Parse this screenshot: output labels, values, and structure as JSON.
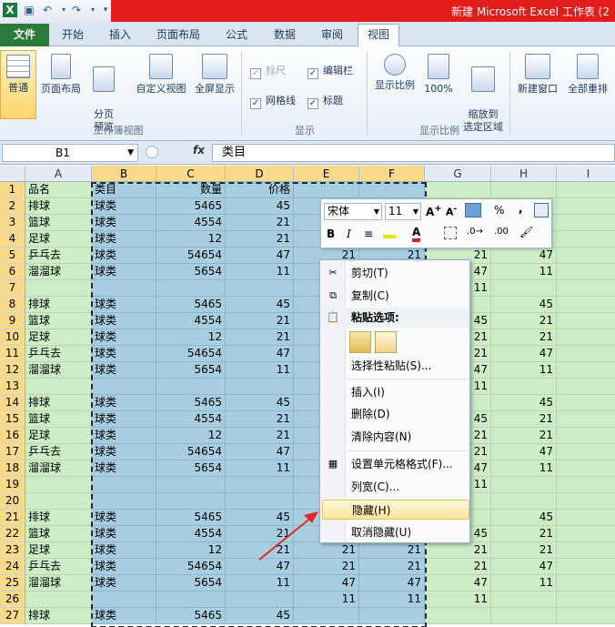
{
  "window": {
    "title": "新建 Microsoft Excel 工作表 (2"
  },
  "tabs": [
    "文件",
    "开始",
    "插入",
    "页面布局",
    "公式",
    "数据",
    "审阅",
    "视图"
  ],
  "ribbon": {
    "btn_normal": "普通",
    "btn_page_layout": "页面布局",
    "btn_page_break": "分页\n预览",
    "btn_custom_view": "自定义视图",
    "btn_full_screen": "全屏显示",
    "group_workbook_view": "工作簿视图",
    "chk_ruler": "标尺",
    "chk_formula_bar": "编辑栏",
    "chk_gridlines": "网格线",
    "chk_headings": "标题",
    "group_show": "显示",
    "btn_zoom": "显示比例",
    "btn_100": "100%",
    "btn_zoom_selection": "缩放到\n选定区域",
    "group_zoom": "显示比例",
    "btn_new_window": "新建窗口",
    "btn_arrange_all": "全部重排"
  },
  "formula_bar": {
    "name_box": "B1",
    "fx": "fx",
    "content": "类目"
  },
  "columns": [
    "A",
    "B",
    "C",
    "D",
    "E",
    "F",
    "G",
    "H",
    "I"
  ],
  "rows": [
    {
      "n": "1",
      "A": "品名",
      "B": "类目",
      "C": "数量",
      "D": "价格",
      "E": "",
      "F": "",
      "G": "",
      "H": ""
    },
    {
      "n": "2",
      "A": "排球",
      "B": "球类",
      "C": "5465",
      "D": "45",
      "E": "",
      "F": "",
      "G": "",
      "H": ""
    },
    {
      "n": "3",
      "A": "篮球",
      "B": "球类",
      "C": "4554",
      "D": "21",
      "E": "",
      "F": "",
      "G": "",
      "H": ""
    },
    {
      "n": "4",
      "A": "足球",
      "B": "球类",
      "C": "12",
      "D": "21",
      "E": "",
      "F": "",
      "G": "",
      "H": ""
    },
    {
      "n": "5",
      "A": "乒乓去",
      "B": "球类",
      "C": "54654",
      "D": "47",
      "E": "21",
      "F": "21",
      "G": "21",
      "H": "47"
    },
    {
      "n": "6",
      "A": "溜溜球",
      "B": "球类",
      "C": "5654",
      "D": "11",
      "E": "",
      "F": "",
      "G": "47",
      "H": "11"
    },
    {
      "n": "7",
      "A": "",
      "B": "",
      "C": "",
      "D": "",
      "E": "",
      "F": "",
      "G": "11",
      "H": ""
    },
    {
      "n": "8",
      "A": "排球",
      "B": "球类",
      "C": "5465",
      "D": "45",
      "E": "",
      "F": "",
      "G": "",
      "H": "45"
    },
    {
      "n": "9",
      "A": "篮球",
      "B": "球类",
      "C": "4554",
      "D": "21",
      "E": "",
      "F": "",
      "G": "45",
      "H": "21"
    },
    {
      "n": "10",
      "A": "足球",
      "B": "球类",
      "C": "12",
      "D": "21",
      "E": "",
      "F": "",
      "G": "21",
      "H": "21"
    },
    {
      "n": "11",
      "A": "乒乓去",
      "B": "球类",
      "C": "54654",
      "D": "47",
      "E": "",
      "F": "",
      "G": "21",
      "H": "47"
    },
    {
      "n": "12",
      "A": "溜溜球",
      "B": "球类",
      "C": "5654",
      "D": "11",
      "E": "",
      "F": "",
      "G": "47",
      "H": "11"
    },
    {
      "n": "13",
      "A": "",
      "B": "",
      "C": "",
      "D": "",
      "E": "",
      "F": "",
      "G": "11",
      "H": ""
    },
    {
      "n": "14",
      "A": "排球",
      "B": "球类",
      "C": "5465",
      "D": "45",
      "E": "",
      "F": "",
      "G": "",
      "H": "45"
    },
    {
      "n": "15",
      "A": "篮球",
      "B": "球类",
      "C": "4554",
      "D": "21",
      "E": "",
      "F": "",
      "G": "45",
      "H": "21"
    },
    {
      "n": "16",
      "A": "足球",
      "B": "球类",
      "C": "12",
      "D": "21",
      "E": "",
      "F": "",
      "G": "21",
      "H": "21"
    },
    {
      "n": "17",
      "A": "乒乓去",
      "B": "球类",
      "C": "54654",
      "D": "47",
      "E": "",
      "F": "",
      "G": "21",
      "H": "47"
    },
    {
      "n": "18",
      "A": "溜溜球",
      "B": "球类",
      "C": "5654",
      "D": "11",
      "E": "",
      "F": "",
      "G": "47",
      "H": "11"
    },
    {
      "n": "19",
      "A": "",
      "B": "",
      "C": "",
      "D": "",
      "E": "",
      "F": "",
      "G": "11",
      "H": ""
    },
    {
      "n": "20",
      "A": "",
      "B": "",
      "C": "",
      "D": "",
      "E": "",
      "F": "",
      "G": "",
      "H": ""
    },
    {
      "n": "21",
      "A": "排球",
      "B": "球类",
      "C": "5465",
      "D": "45",
      "E": "",
      "F": "",
      "G": "",
      "H": "45"
    },
    {
      "n": "22",
      "A": "篮球",
      "B": "球类",
      "C": "4554",
      "D": "21",
      "E": "",
      "F": "",
      "G": "45",
      "H": "21"
    },
    {
      "n": "23",
      "A": "足球",
      "B": "球类",
      "C": "12",
      "D": "21",
      "E": "21",
      "F": "21",
      "G": "21",
      "H": "21"
    },
    {
      "n": "24",
      "A": "乒乓去",
      "B": "球类",
      "C": "54654",
      "D": "47",
      "E": "21",
      "F": "21",
      "G": "21",
      "H": "47"
    },
    {
      "n": "25",
      "A": "溜溜球",
      "B": "球类",
      "C": "5654",
      "D": "11",
      "E": "47",
      "F": "47",
      "G": "47",
      "H": "11"
    },
    {
      "n": "26",
      "A": "",
      "B": "",
      "C": "",
      "D": "",
      "E": "11",
      "F": "11",
      "G": "11",
      "H": ""
    },
    {
      "n": "27",
      "A": "排球",
      "B": "球类",
      "C": "5465",
      "D": "45",
      "E": "",
      "F": "",
      "G": "",
      "H": ""
    }
  ],
  "mini_toolbar": {
    "font": "宋体",
    "size": "11",
    "percent": "%",
    "comma": ",",
    "bold": "B",
    "italic": "I"
  },
  "context_menu": {
    "cut": "剪切(T)",
    "copy": "复制(C)",
    "paste_options": "粘贴选项:",
    "paste_special": "选择性粘贴(S)...",
    "insert": "插入(I)",
    "delete": "删除(D)",
    "clear": "清除内容(N)",
    "format_cells": "设置单元格格式(F)...",
    "col_width": "列宽(C)...",
    "hide": "隐藏(H)",
    "unhide": "取消隐藏(U)"
  },
  "colors": {
    "selection": "#a7cde1",
    "sheet": "#ccedc6",
    "header_selected": "#f9d98a",
    "accent_red": "#e31c1c"
  }
}
